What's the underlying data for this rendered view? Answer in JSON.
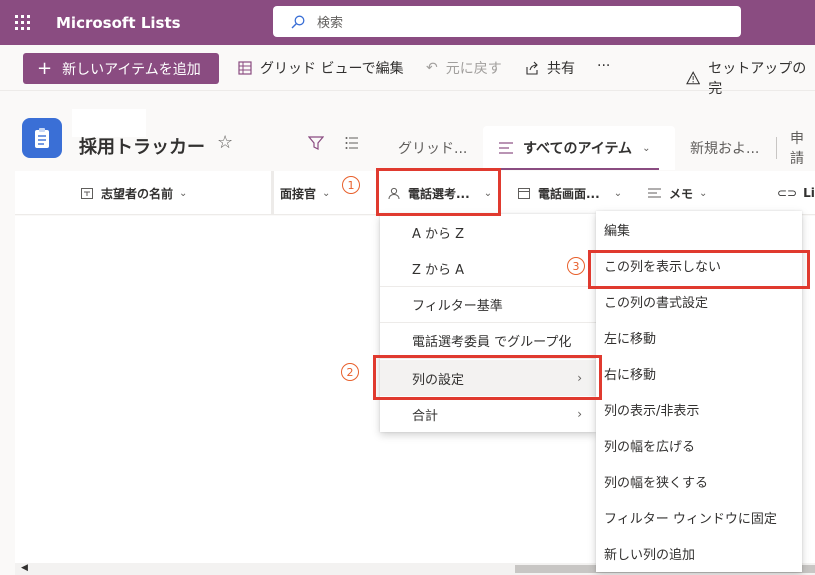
{
  "header": {
    "app_name": "Microsoft Lists",
    "search_placeholder": "検索"
  },
  "commandbar": {
    "new_item": "新しいアイテムを追加",
    "grid_edit": "グリッド ビューで編集",
    "undo": "元に戻す",
    "share": "共有",
    "more": "···",
    "setup": "セットアップの完"
  },
  "list": {
    "title": "採用トラッカー"
  },
  "tabs": [
    {
      "label": "グリッド..."
    },
    {
      "label": "すべてのアイテム"
    },
    {
      "label": "新規およ..."
    },
    {
      "label": "申請"
    }
  ],
  "columns": [
    {
      "label": "志望者の名前"
    },
    {
      "label": "面接官"
    },
    {
      "label": "電話選考..."
    },
    {
      "label": "電話画面..."
    },
    {
      "label": "メモ"
    },
    {
      "label": "Lin"
    }
  ],
  "column_menu": [
    {
      "label": "A から Z"
    },
    {
      "label": "Z から A"
    },
    {
      "label": "フィルター基準"
    },
    {
      "label": "電話選考委員 でグループ化"
    },
    {
      "label": "列の設定"
    },
    {
      "label": "合計"
    }
  ],
  "settings_menu": [
    {
      "label": "編集"
    },
    {
      "label": "この列を表示しない"
    },
    {
      "label": "この列の書式設定"
    },
    {
      "label": "左に移動"
    },
    {
      "label": "右に移動"
    },
    {
      "label": "列の表示/非表示"
    },
    {
      "label": "列の幅を広げる"
    },
    {
      "label": "列の幅を狭くする"
    },
    {
      "label": "フィルター ウィンドウに固定"
    },
    {
      "label": "新しい列の追加"
    }
  ],
  "annotations": {
    "step1": "1",
    "step2": "2",
    "step3": "3"
  },
  "colors": {
    "brand": "#8a4c81",
    "highlight": "#e03a2f",
    "step": "#e8602c"
  }
}
